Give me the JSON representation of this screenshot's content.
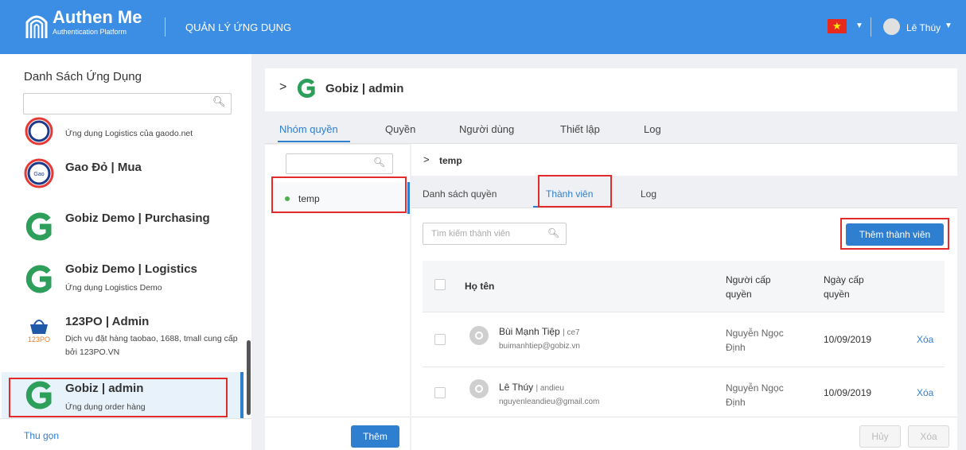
{
  "header": {
    "brand_name": "Authen Me",
    "brand_sub": "Authentication Platform",
    "menu_label": "QUẢN LÝ ỨNG DỤNG",
    "flag_icon": "vietnam-flag-icon",
    "user_name": "Lê Thúy",
    "bg_color": "#3b8ee3"
  },
  "sidebar": {
    "title": "Danh Sách Ứng Dụng",
    "search_placeholder": "",
    "apps": [
      {
        "name": "",
        "desc": "Ứng dụng Logistics của gaodo.net",
        "icon": "gaodo-logo-icon"
      },
      {
        "name": "Gao Đỏ | Mua",
        "desc": "",
        "icon": "gaodo-logo-icon"
      },
      {
        "name": "Gobiz Demo | Purchasing",
        "desc": "",
        "icon": "gobiz-logo-icon"
      },
      {
        "name": "Gobiz Demo | Logistics",
        "desc": "Ứng dụng Logistics Demo",
        "icon": "gobiz-logo-icon"
      },
      {
        "name": "123PO | Admin",
        "desc": "Dịch vụ đặt hàng taobao, 1688, tmall cung cấp bởi 123PO.VN",
        "icon": "123po-logo-icon"
      },
      {
        "name": "Gobiz | admin",
        "desc": "Ứng dụng order hàng",
        "icon": "gobiz-logo-icon",
        "selected": true
      }
    ],
    "collapse_label": "Thu gọn"
  },
  "main": {
    "title": "Gobiz | admin",
    "tabs": [
      "Nhóm quyền",
      "Quyền",
      "Người dùng",
      "Thiết lập",
      "Log"
    ],
    "active_tab": "Nhóm quyền"
  },
  "roles": {
    "search_placeholder": "",
    "items": [
      {
        "name": "temp"
      }
    ],
    "add_label": "Thêm"
  },
  "detail": {
    "title": "temp",
    "tabs": [
      "Danh sách quyền",
      "Thành viên",
      "Log"
    ],
    "active_tab": "Thành viên",
    "search_placeholder": "Tìm kiếm thành viên",
    "add_member_label": "Thêm thành viên",
    "columns": {
      "name": "Họ tên",
      "granter_line1": "Người cấp",
      "granter_line2": "quyền",
      "date_line1": "Ngày cấp",
      "date_line2": "quyền"
    },
    "members": [
      {
        "name": "Bùi Mạnh Tiệp",
        "username": "ce7",
        "email": "buimanhtiep@gobiz.vn",
        "granter_line1": "Nguyễn Ngọc",
        "granter_line2": "Định",
        "date": "10/09/2019",
        "action": "Xóa"
      },
      {
        "name": "Lê Thúy",
        "username": "andieu",
        "email": "nguyenleandieu@gmail.com",
        "granter_line1": "Nguyễn Ngọc",
        "granter_line2": "Định",
        "date": "10/09/2019",
        "action": "Xóa"
      }
    ],
    "cancel_label": "Hủy",
    "delete_label": "Xóa"
  },
  "colors": {
    "accent": "#2f7fd0",
    "highlight": "#e32b2b"
  }
}
